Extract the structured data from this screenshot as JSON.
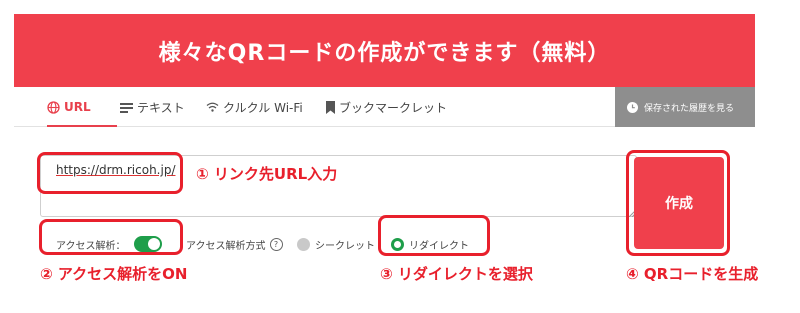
{
  "banner": {
    "title": "様々なQRコードの作成ができます（無料）"
  },
  "tabs": [
    {
      "label": "URL",
      "icon": "globe-icon",
      "active": true
    },
    {
      "label": "テキスト",
      "icon": "lines-icon",
      "active": false
    },
    {
      "label": "クルクル Wi-Fi",
      "icon": "wifi-icon",
      "active": false
    },
    {
      "label": "ブックマークレット",
      "icon": "bookmark-icon",
      "active": false
    }
  ],
  "history_button": {
    "label": "保存された履歴を見る",
    "icon": "clock-icon"
  },
  "url_input": {
    "value_prefix": "https",
    "value_rest": "://drm.ricoh.jp/"
  },
  "options": {
    "analytics_label": "アクセス解析：",
    "analytics_on": true,
    "method_label": "アクセス解析方式",
    "help_glyph": "?",
    "method_secret": "シークレット",
    "method_redirect": "リダイレクト",
    "selected_method": "リダイレクト"
  },
  "create_button": {
    "label": "作成"
  },
  "annotations": {
    "step1": "① リンク先URL入力",
    "step2": "② アクセス解析をON",
    "step3": "③ リダイレクトを選択",
    "step4": "④ QRコードを生成"
  },
  "colors": {
    "brand_red": "#f0404c",
    "highlight_red": "#e8202c",
    "toggle_green": "#1e9e4a"
  }
}
